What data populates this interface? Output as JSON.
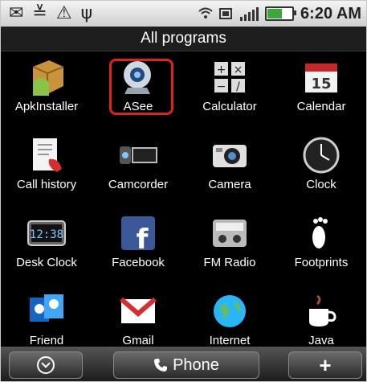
{
  "status_bar": {
    "left_icons": "✉ ≚ ⚠ ψ",
    "time": "6:20 AM",
    "battery_level": 0.6
  },
  "title": "All programs",
  "apps": [
    {
      "label": "ApkInstaller",
      "icon": "box-android-icon"
    },
    {
      "label": "ASee",
      "icon": "webcam-icon"
    },
    {
      "label": "Calculator",
      "icon": "calculator-icon"
    },
    {
      "label": "Calendar",
      "icon": "calendar-icon"
    },
    {
      "label": "Call history",
      "icon": "call-history-icon"
    },
    {
      "label": "Camcorder",
      "icon": "camcorder-icon"
    },
    {
      "label": "Camera",
      "icon": "camera-icon"
    },
    {
      "label": "Clock",
      "icon": "clock-icon"
    },
    {
      "label": "Desk Clock",
      "icon": "desk-clock-icon"
    },
    {
      "label": "Facebook",
      "icon": "facebook-icon"
    },
    {
      "label": "FM Radio",
      "icon": "fm-radio-icon"
    },
    {
      "label": "Footprints",
      "icon": "footprints-icon"
    },
    {
      "label": "Friend\nStream",
      "icon": "friend-stream-icon"
    },
    {
      "label": "Gmail",
      "icon": "gmail-icon"
    },
    {
      "label": "Internet",
      "icon": "globe-icon"
    },
    {
      "label": "Java",
      "icon": "java-cup-icon"
    }
  ],
  "calendar_day": "15",
  "desk_clock_time": "12:38",
  "bottom_bar": {
    "phone_label": "Phone",
    "add_label": "+"
  },
  "colors": {
    "highlight": "#dd2222",
    "title_bg": "#1e1e1e"
  }
}
